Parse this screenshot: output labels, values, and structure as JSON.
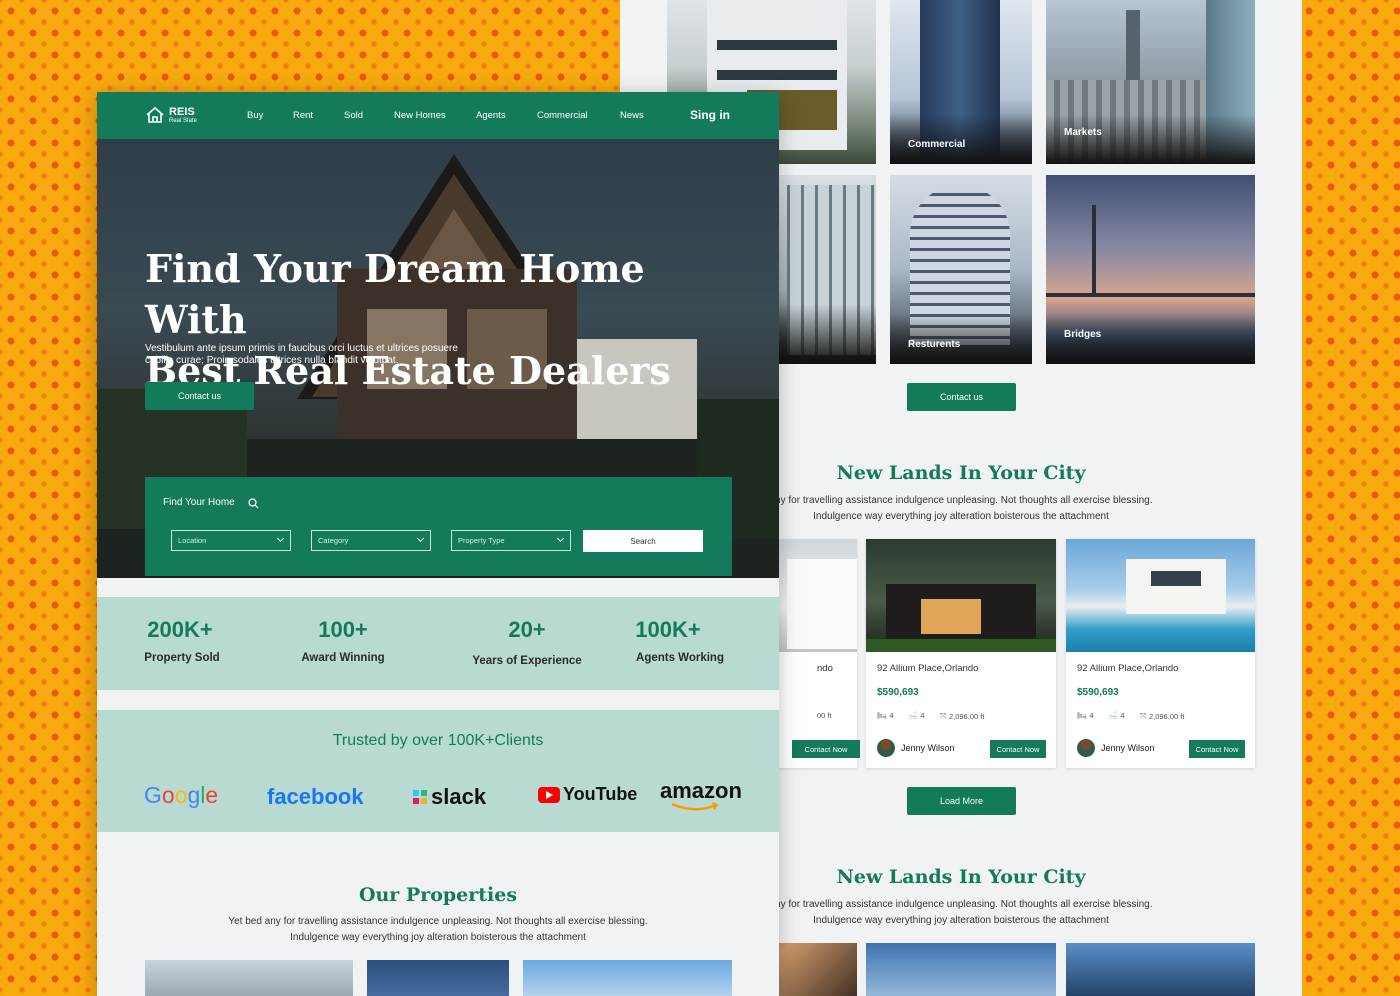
{
  "colors": {
    "primary": "#137a5c",
    "accent_light": "#b9dad3"
  },
  "back_page": {
    "tiles": [
      {
        "label": ""
      },
      {
        "label": "Commercial"
      },
      {
        "label": "Markets"
      },
      {
        "label": ""
      },
      {
        "label": "Resturents"
      },
      {
        "label": "Bridges"
      }
    ],
    "contact_button": "Contact us",
    "section1": {
      "title": "New Lands In Your City",
      "subtitle_line1": "any for travelling assistance indulgence unpleasing. Not thoughts all exercise blessing.",
      "subtitle_line2": "Indulgence way everything joy alteration boisterous the attachment"
    },
    "cards": [
      {
        "address": "ndo",
        "price": "",
        "beds": "",
        "baths": "",
        "area": "00 ft",
        "agent": "",
        "contact": "Contact Now"
      },
      {
        "address": "92 Allium Place,Orlando",
        "price": "$590,693",
        "beds": "4",
        "baths": "4",
        "area": "2,096.00 ft",
        "agent": "Jenny Wilson",
        "contact": "Contact Now"
      },
      {
        "address": "92 Allium Place,Orlando",
        "price": "$590,693",
        "beds": "4",
        "baths": "4",
        "area": "2,096.00 ft",
        "agent": "Jenny Wilson",
        "contact": "Contact Now"
      }
    ],
    "load_more": "Load More",
    "section2": {
      "title": "New Lands In Your City",
      "subtitle_line1": "any for travelling assistance indulgence unpleasing. Not thoughts all exercise blessing.",
      "subtitle_line2": "Indulgence way everything joy alteration boisterous the attachment"
    }
  },
  "front_page": {
    "logo": {
      "name": "REIS",
      "tagline": "Real State"
    },
    "nav": [
      "Buy",
      "Rent",
      "Sold",
      "New Homes",
      "Agents",
      "Commercial",
      "News"
    ],
    "signin": "Sing in",
    "hero": {
      "title_line1": "Find Your Dream Home With",
      "title_line2": "Best Real Estate Dealers",
      "subtitle_line1": "Vestibulum ante ipsum primis in faucibus orci luctus et ultrices posuere",
      "subtitle_line2": "cubilia curae; Proin sodales ultrices nulla blandit volutpat.",
      "cta": "Contact us"
    },
    "search": {
      "heading": "Find Your Home",
      "location": "Location",
      "category": "Category",
      "property_type": "Property Type",
      "button": "Search"
    },
    "stats": [
      {
        "value": "200K+",
        "label": "Property Sold"
      },
      {
        "value": "100+",
        "label": "Award Winning"
      },
      {
        "value": "20+",
        "label": "Years of Experience"
      },
      {
        "value": "100K+",
        "label": "Agents Working"
      }
    ],
    "trusted": {
      "heading": "Trusted by over 100K+Clients",
      "logos": [
        "Google",
        "facebook",
        "slack",
        "YouTube",
        "amazon"
      ]
    },
    "properties": {
      "title": "Our Properties",
      "subtitle_line1": "Yet bed any for travelling assistance indulgence unpleasing. Not thoughts all exercise blessing.",
      "subtitle_line2": "Indulgence way everything joy alteration boisterous the attachment"
    }
  }
}
